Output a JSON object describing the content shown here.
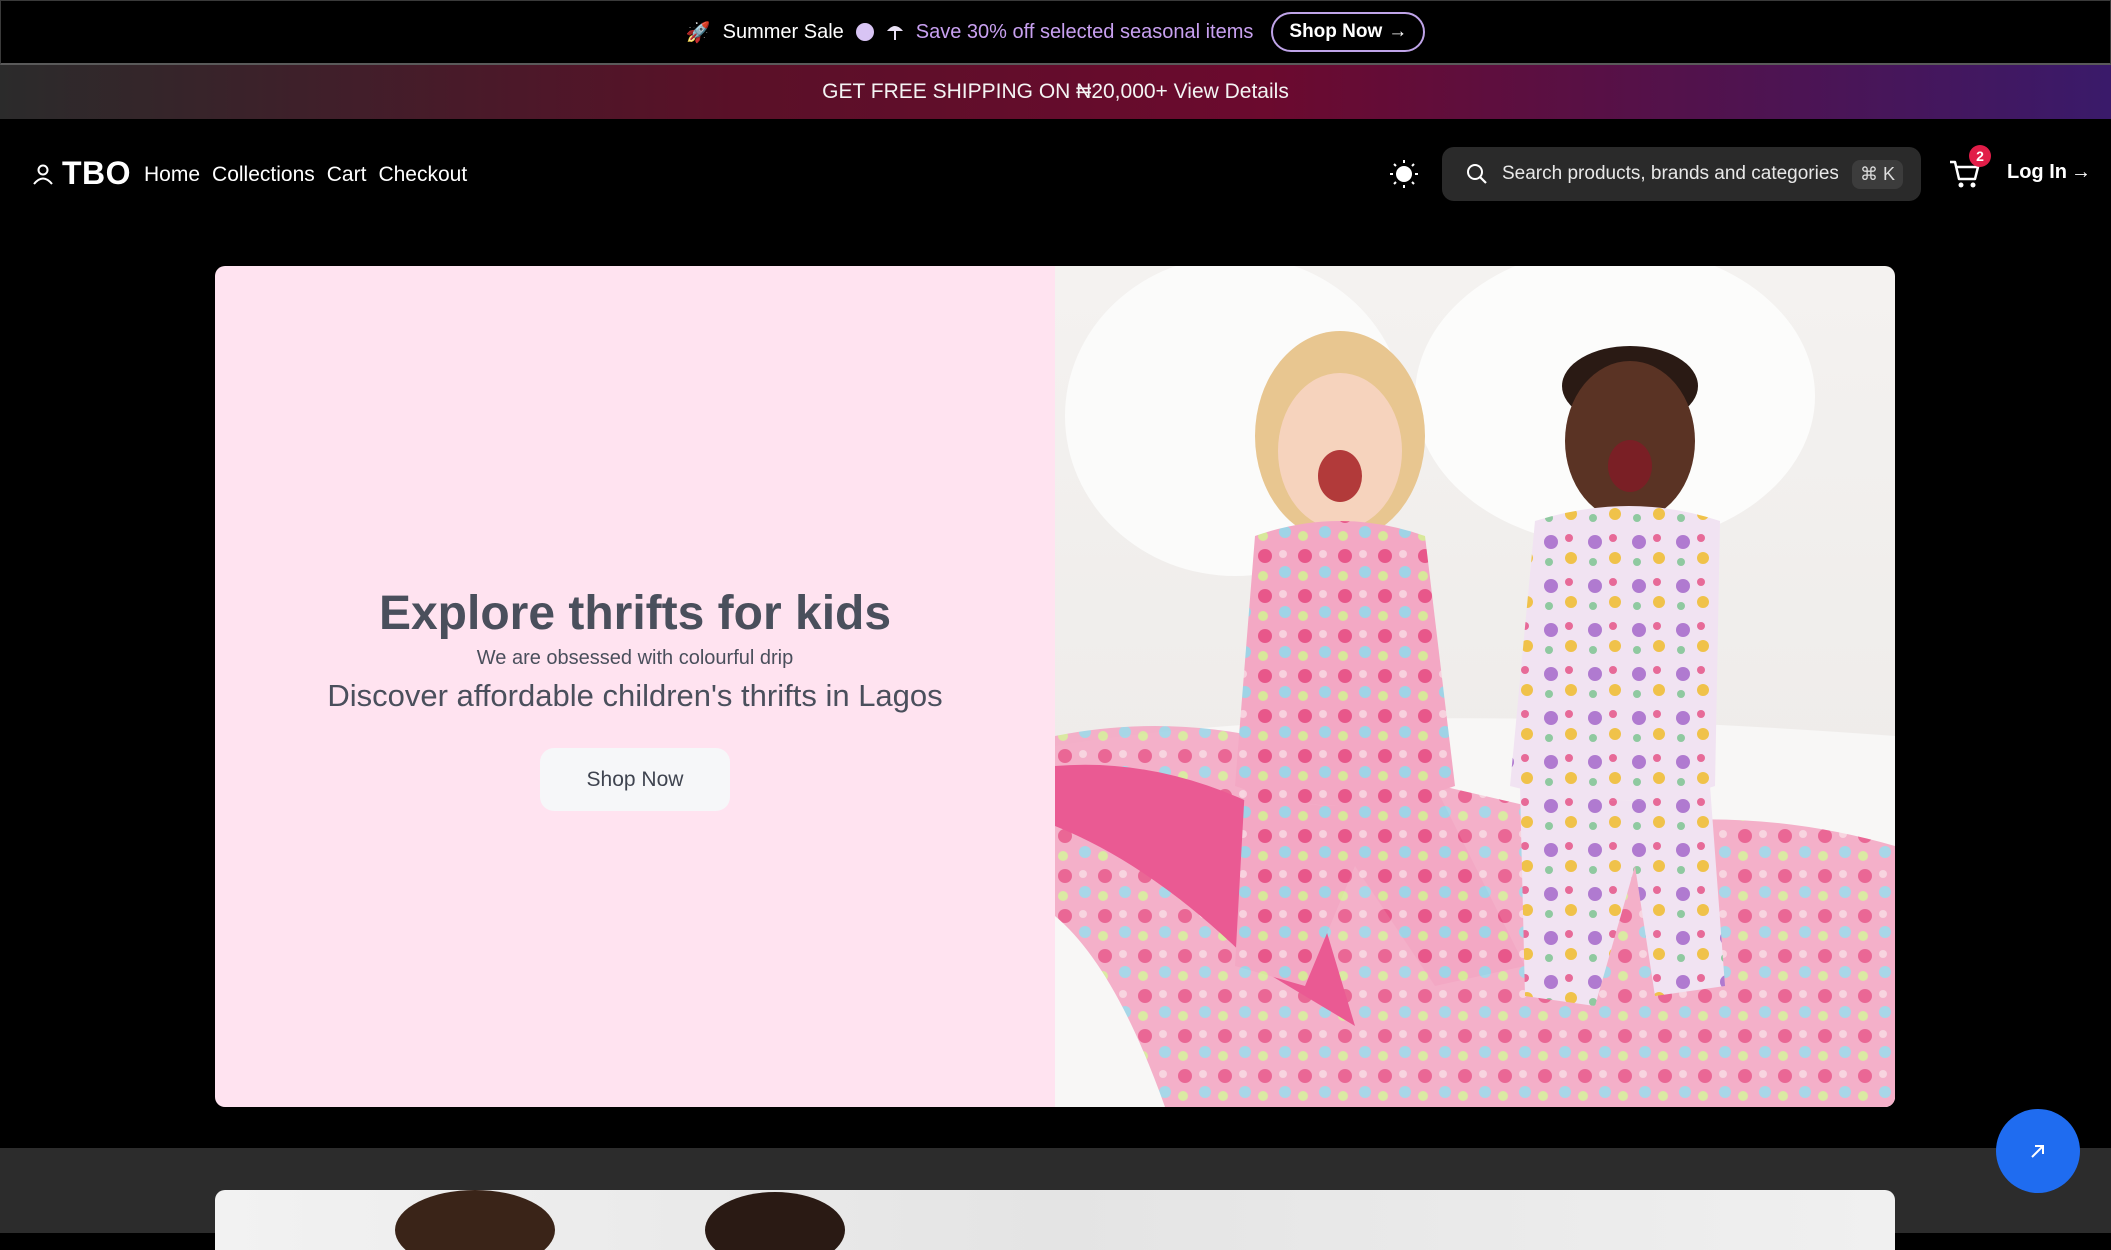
{
  "announcement": {
    "rocket": "🚀",
    "sale_label": "Summer Sale",
    "save_text": "Save 30% off",
    "selected_text": "selected seasonal items",
    "button_label": "Shop Now",
    "arrow": "→"
  },
  "shipping": {
    "text": "GET FREE SHIPPING ON ₦20,000+ View Details"
  },
  "nav": {
    "brand": "TBO",
    "links": [
      "Home",
      "Collections",
      "Cart",
      "Checkout"
    ],
    "search_placeholder": "Search products, brands and categories...",
    "shortcut": "⌘ K",
    "cart_count": "2",
    "login_label": "Log In",
    "login_arrow": "→"
  },
  "hero": {
    "title": "Explore thrifts for kids",
    "subtitle": "We are obsessed with colourful drip",
    "description": "Discover affordable children's thrifts in Lagos",
    "button_label": "Shop Now"
  },
  "colors": {
    "accent_blue": "#1f6cf0",
    "hero_pink": "#ffe3f0",
    "badge_red": "#e11d48"
  }
}
